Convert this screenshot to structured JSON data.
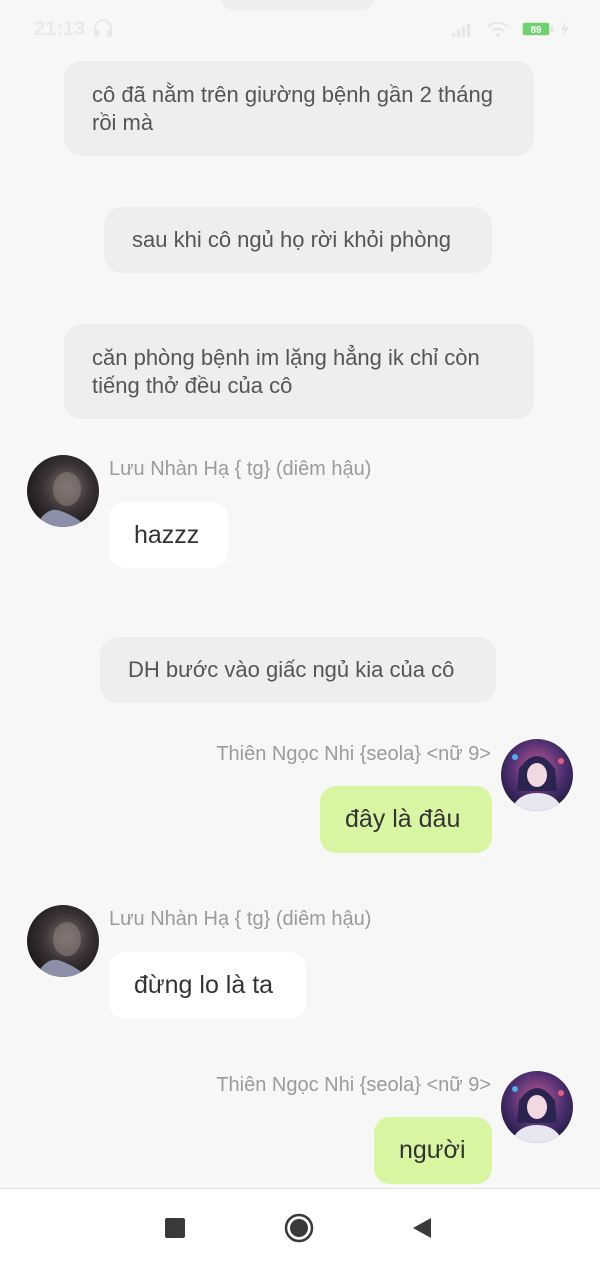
{
  "status_bar": {
    "time": "21:13",
    "battery": "89",
    "icons": [
      "headphones-icon",
      "signal-icon",
      "wifi-icon",
      "battery-icon",
      "charging-icon"
    ]
  },
  "messages": {
    "narration_1": "cô đã nằm trên giường bệnh gần 2 tháng rồi mà",
    "narration_2": "sau khi cô ngủ họ rời khỏi phòng",
    "narration_3": "căn phòng bệnh im lặng hẳng ik chỉ còn tiếng thở đều của cô",
    "msg_1": {
      "sender": "Lưu Nhàn Hạ { tg} (diêm hậu)",
      "text": "hazzz"
    },
    "narration_4": "DH bước vào giấc ngủ kia của cô",
    "msg_2": {
      "sender": "Thiên Ngọc Nhi {seola} <nữ 9>",
      "text": "đây là đâu"
    },
    "msg_3": {
      "sender": "Lưu Nhàn Hạ { tg} (diêm hậu)",
      "text": "đừng lo là ta"
    },
    "msg_4": {
      "sender": "Thiên Ngọc Nhi {seola} <nữ 9>",
      "text": "người"
    }
  },
  "nav_bar": {
    "buttons": [
      "recent-apps-button",
      "home-button",
      "back-button"
    ]
  },
  "colors": {
    "background": "#f7f7f7",
    "narration_bubble": "#eeeeee",
    "incoming_bubble": "#ffffff",
    "outgoing_bubble": "#d8f5a2",
    "sender_name": "#9b9b9b"
  }
}
